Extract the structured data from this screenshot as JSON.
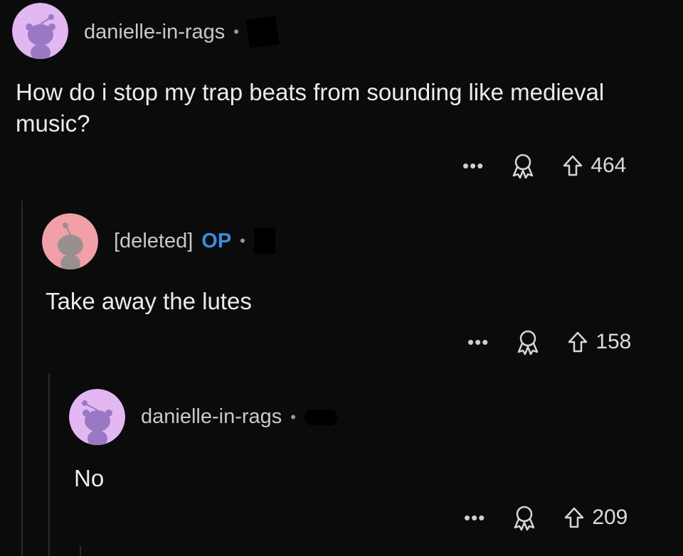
{
  "post": {
    "author": "danielle-in-rags",
    "separator": "•",
    "body": "How do i stop my trap beats from sounding like medieval music?",
    "more": "•••",
    "score": "464",
    "avatar_color": "#e3b7f2"
  },
  "comments": [
    {
      "author": "[deleted]",
      "op_badge": "OP",
      "separator": "•",
      "body": "Take away the lutes",
      "more": "•••",
      "score": "158",
      "avatar_color": "#f2a0a8"
    },
    {
      "author": "danielle-in-rags",
      "separator": "•",
      "body": "No",
      "more": "•••",
      "score": "209",
      "avatar_color": "#e3b7f2"
    }
  ],
  "colors": {
    "background": "#0b0b0c",
    "op_badge": "#3d8be0",
    "snoo_purple": "#9a79c4",
    "snoo_gray": "#9a8f90"
  },
  "icons": [
    "snoo-avatar-icon",
    "award-icon",
    "upvote-icon",
    "more-options-icon"
  ]
}
